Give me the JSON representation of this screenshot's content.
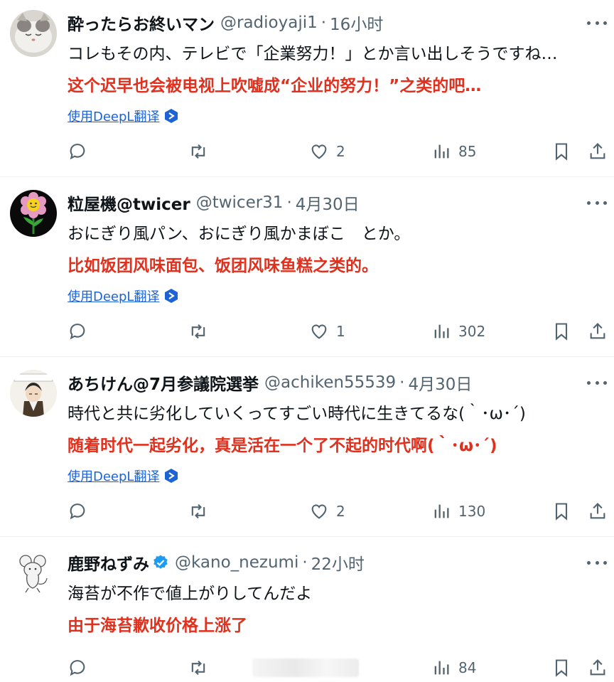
{
  "tweets": [
    {
      "name": "酔ったらお終いマン",
      "handle": "@radioyaji1",
      "time": "16小时",
      "text_jp": "コレもその内、テレビで「企業努力！」とか言い出しそうですね…",
      "text_cn": "这个迟早也会被电视上吹嘘成“企业的努力！”之类的吧…",
      "translate": "使用DeepL翻译",
      "replies": "",
      "retweets": "",
      "likes": "2",
      "views": "85",
      "verified": false
    },
    {
      "name": "粒屋機@twicer",
      "handle": "@twicer31",
      "time": "4月30日",
      "text_jp": "おにぎり風パン、おにぎり風かまぼこ　とか。",
      "text_cn": "比如饭团风味面包、饭团风味鱼糕之类的。",
      "translate": "使用DeepL翻译",
      "replies": "",
      "retweets": "",
      "likes": "1",
      "views": "302",
      "verified": false
    },
    {
      "name": "あちけん@7月参議院選挙",
      "handle": "@achiken55539",
      "time": "4月30日",
      "text_jp": "時代と共に劣化していくってすごい時代に生きてるな(｀･ω･´)",
      "text_cn": "随着时代一起劣化，真是活在一个了不起的时代啊(｀･ω･´)",
      "translate": "使用DeepL翻译",
      "replies": "",
      "retweets": "",
      "likes": "2",
      "views": "130",
      "verified": false
    },
    {
      "name": "鹿野ねずみ",
      "handle": "@kano_nezumi",
      "time": "22小时",
      "text_jp": "海苔が不作で値上がりしてんだよ",
      "text_cn": "由于海苔歉收价格上涨了",
      "translate": "",
      "replies": "",
      "retweets": "",
      "likes": "",
      "views": "84",
      "verified": true
    }
  ],
  "separator": "·",
  "colors": {
    "name": "#0f1419",
    "secondary": "#536471",
    "translation_red": "#e0301e",
    "link_blue": "#1d63d6",
    "verified_blue": "#1d9bf0",
    "divider": "#eff3f4"
  },
  "icons": {
    "reply": "speech-bubble-icon",
    "retweet": "retweet-icon",
    "like": "heart-icon",
    "views": "bar-chart-icon",
    "bookmark": "bookmark-icon",
    "share": "share-icon",
    "more": "more-dots-icon",
    "deepl": "deepl-icon",
    "verified": "verified-badge-icon"
  }
}
